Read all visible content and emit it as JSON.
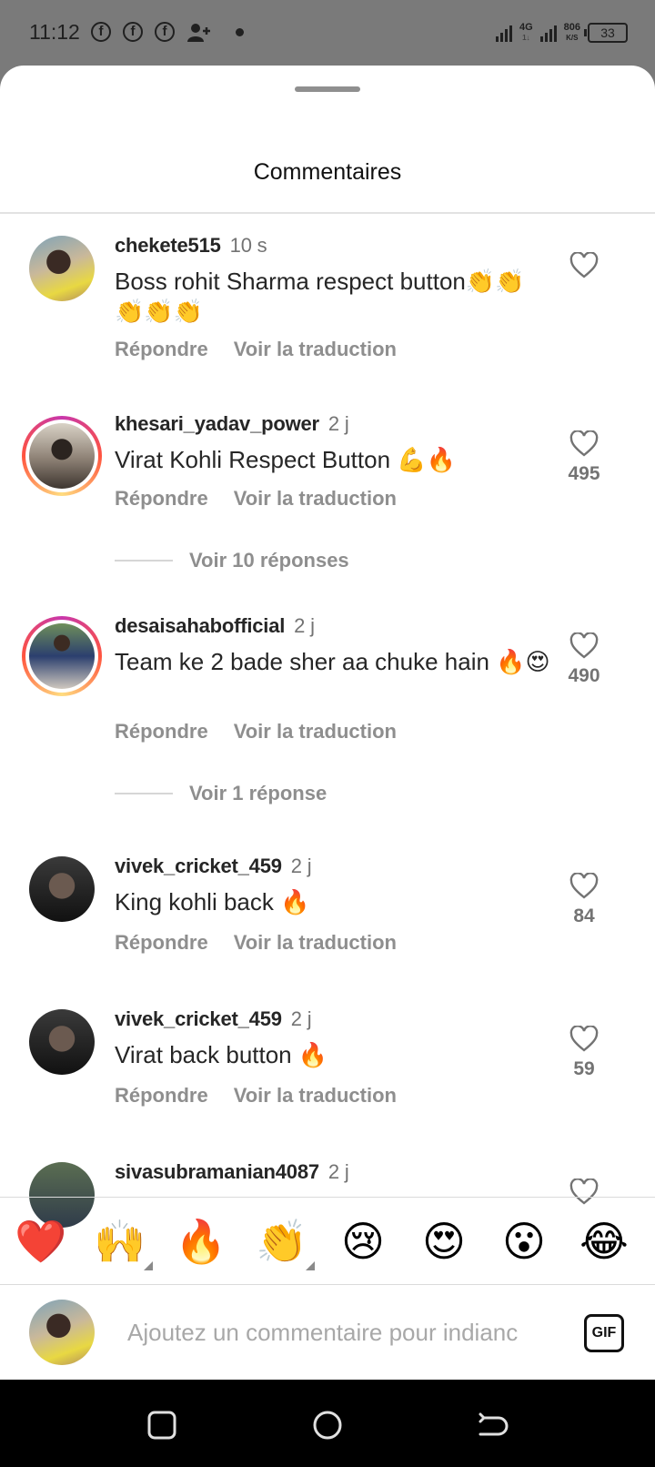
{
  "status_bar": {
    "time": "11:12",
    "notif_icons": [
      "facebook-icon",
      "facebook-icon",
      "facebook-icon",
      "add-contact-icon"
    ],
    "network": "4G",
    "network_sub": "1↓",
    "speed_value": "806",
    "speed_unit": "K/S",
    "battery": "33"
  },
  "sheet": {
    "title": "Commentaires"
  },
  "comments": [
    {
      "username": "chekete515",
      "time": "10 s",
      "text": "Boss rohit Sharma respect button👏👏👏👏👏",
      "reply_label": "Répondre",
      "translate_label": "Voir la traduction",
      "likes": "",
      "story_ring": false
    },
    {
      "username": "khesari_yadav_power",
      "time": "2 j",
      "text": "Virat Kohli Respect Button 💪🔥",
      "reply_label": "Répondre",
      "translate_label": "Voir la traduction",
      "likes": "495",
      "story_ring": true,
      "replies_label": "Voir 10 réponses"
    },
    {
      "username": "desaisahabofficial",
      "time": "2 j",
      "text": "Team ke 2 bade sher aa chuke hain 🔥😍",
      "reply_label": "Répondre",
      "translate_label": "Voir la traduction",
      "likes": "490",
      "story_ring": true,
      "replies_label": "Voir 1 réponse"
    },
    {
      "username": "vivek_cricket_459",
      "time": "2 j",
      "text": "King kohli back 🔥",
      "reply_label": "Répondre",
      "translate_label": "Voir la traduction",
      "likes": "84",
      "story_ring": false
    },
    {
      "username": "vivek_cricket_459",
      "time": "2 j",
      "text": "Virat back button 🔥",
      "reply_label": "Répondre",
      "translate_label": "Voir la traduction",
      "likes": "59",
      "story_ring": false
    },
    {
      "username": "sivasubramanian4087",
      "time": "2 j",
      "text": "",
      "likes": "",
      "story_ring": false
    }
  ],
  "emoji_bar": {
    "emojis": [
      "❤️",
      "🙌",
      "🔥",
      "👏",
      "😢",
      "😍",
      "😮",
      "😂"
    ]
  },
  "composer": {
    "placeholder": "Ajoutez un commentaire pour indianc",
    "gif_label": "GIF"
  },
  "colors": {
    "background": "#ffffff",
    "secondary_text": "#8e8e8e",
    "status_bar": "#7a7a7a",
    "nav_bar": "#000000"
  }
}
